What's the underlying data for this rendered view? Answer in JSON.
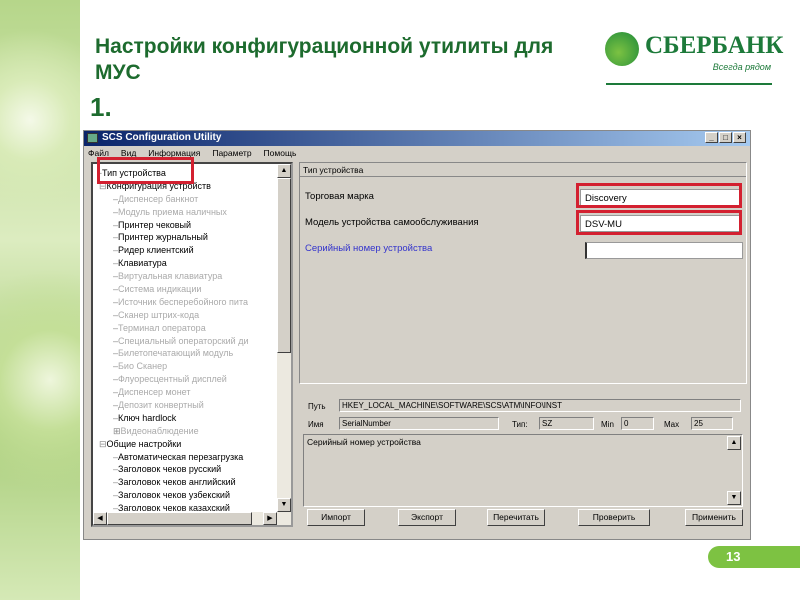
{
  "slide": {
    "title": "Настройки конфигурационной утилиты для МУС",
    "step": "1.",
    "page": "13"
  },
  "logo": {
    "name": "СБЕРБАНК",
    "tagline": "Всегда рядом"
  },
  "window": {
    "title": "SCS Configuration Utility",
    "controls": [
      "_",
      "□",
      "×"
    ],
    "menu": [
      "Файл",
      "Вид",
      "Информация",
      "Параметр",
      "Помощь"
    ]
  },
  "tree": [
    {
      "label": "Тип устройства",
      "level": 0,
      "enabled": true,
      "prefix": "-"
    },
    {
      "label": "Конфигурация устройств",
      "level": 0,
      "enabled": true,
      "prefix": "⊟"
    },
    {
      "label": "Диспенсер банкнот",
      "level": 1,
      "enabled": false
    },
    {
      "label": "Модуль приема наличных",
      "level": 1,
      "enabled": false
    },
    {
      "label": "Принтер чековый",
      "level": 1,
      "enabled": true
    },
    {
      "label": "Принтер журнальный",
      "level": 1,
      "enabled": true
    },
    {
      "label": "Ридер клиентский",
      "level": 1,
      "enabled": true
    },
    {
      "label": "Клавиатура",
      "level": 1,
      "enabled": true
    },
    {
      "label": "Виртуальная клавиатура",
      "level": 1,
      "enabled": false
    },
    {
      "label": "Система индикации",
      "level": 1,
      "enabled": false
    },
    {
      "label": "Источник бесперебойного пита",
      "level": 1,
      "enabled": false
    },
    {
      "label": "Сканер штрих-кода",
      "level": 1,
      "enabled": false
    },
    {
      "label": "Терминал оператора",
      "level": 1,
      "enabled": false
    },
    {
      "label": "Специальный операторский ди",
      "level": 1,
      "enabled": false
    },
    {
      "label": "Билетопечатающий модуль",
      "level": 1,
      "enabled": false
    },
    {
      "label": "Био Сканер",
      "level": 1,
      "enabled": false
    },
    {
      "label": "Флуоресцентный дисплей",
      "level": 1,
      "enabled": false
    },
    {
      "label": "Диспенсер монет",
      "level": 1,
      "enabled": false
    },
    {
      "label": "Депозит конвертный",
      "level": 1,
      "enabled": false
    },
    {
      "label": "Ключ hardlock",
      "level": 1,
      "enabled": true
    },
    {
      "label": "Видеонаблюдение",
      "level": 1,
      "enabled": false,
      "prefix": "⊞"
    },
    {
      "label": "Общие настройки",
      "level": 0,
      "enabled": true,
      "prefix": "⊟"
    },
    {
      "label": "Автоматическая перезагрузка",
      "level": 1,
      "enabled": true
    },
    {
      "label": "Заголовок чеков русский",
      "level": 1,
      "enabled": true
    },
    {
      "label": "Заголовок чеков английский",
      "level": 1,
      "enabled": true
    },
    {
      "label": "Заголовок чеков узбекский",
      "level": 1,
      "enabled": true
    },
    {
      "label": "Заголовок чеков казахский",
      "level": 1,
      "enabled": true
    }
  ],
  "form": {
    "section": "Тип устройства",
    "brand_label": "Торговая марка",
    "brand_value": "Discovery",
    "model_label": "Модель устройства самообслуживания",
    "model_value": "DSV-MU",
    "serial_label": "Серийный номер устройства",
    "serial_value": ""
  },
  "details": {
    "path_label": "Путь",
    "path": "HKEY_LOCAL_MACHINE\\SOFTWARE\\SCS\\ATM\\INFO\\INST",
    "name_label": "Имя",
    "name": "SerialNumber",
    "type_label": "Тип:",
    "type": "SZ",
    "min_label": "Min",
    "min": "0",
    "max_label": "Max",
    "max": "25",
    "description": "Серийный номер устройства"
  },
  "buttons": {
    "import": "Импорт",
    "export": "Экспорт",
    "reread": "Перечитать",
    "check": "Проверить",
    "apply": "Применить"
  },
  "colors": {
    "brand_green": "#1d7a3a",
    "accent_green": "#7dc242",
    "highlight_red": "#d32030",
    "link_blue": "#3333cc"
  }
}
